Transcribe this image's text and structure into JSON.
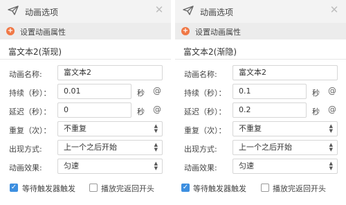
{
  "left": {
    "title": "动画选项",
    "section": "设置动画属性",
    "anim_name": "富文本2(渐现)",
    "labels": {
      "name": "动画名称:",
      "duration": "持续（秒）：",
      "delay": "延迟（秒）：",
      "repeat": "重复（次）：",
      "appear": "出现方式:",
      "effect": "动画效果:"
    },
    "values": {
      "name": "富文本2",
      "duration": "0.01",
      "delay": "0",
      "repeat": "不重复",
      "appear": "上一个之后开始",
      "effect": "匀速"
    },
    "unit": "秒",
    "check1": "等待触发器触发",
    "check2": "播放完返回开头"
  },
  "right": {
    "title": "动画选项",
    "section": "设置动画属性",
    "anim_name": "富文本2(渐隐)",
    "labels": {
      "name": "动画名称:",
      "duration": "持续（秒）：",
      "delay": "延迟（秒）：",
      "repeat": "重复（次）：",
      "appear": "出现方式:",
      "effect": "动画效果:"
    },
    "values": {
      "name": "富文本2",
      "duration": "0.1",
      "delay": "0.2",
      "repeat": "不重复",
      "appear": "上一个之后开始",
      "effect": "匀速"
    },
    "unit": "秒",
    "check1": "等待触发器触发",
    "check2": "播放完返回开头"
  },
  "icons": {
    "title": "send-plane-icon",
    "close": "close-icon",
    "add": "plus-circle-icon",
    "at": "at-icon",
    "select": "select-arrows-icon",
    "check": "checkbox-icon"
  },
  "colors": {
    "accent": "#3d8fe0",
    "add_icon": "#f07846"
  }
}
